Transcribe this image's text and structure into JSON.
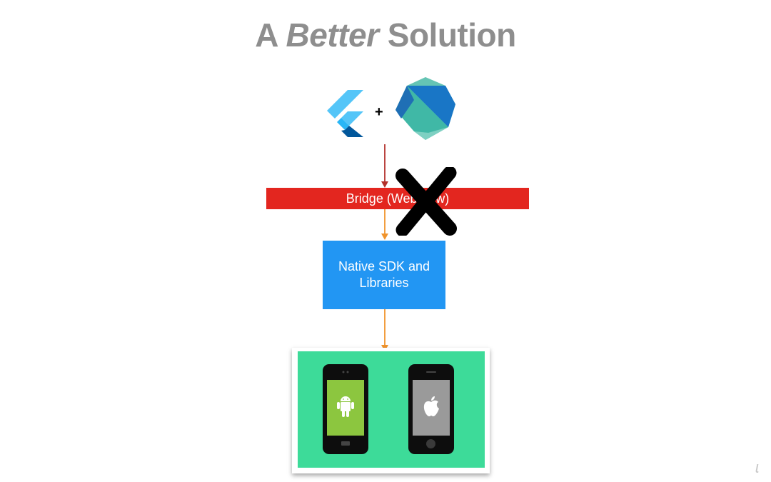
{
  "slide": {
    "title_parts": {
      "prefix": "A ",
      "emphasis": "Better",
      "suffix": " Solution"
    },
    "logos": {
      "left": {
        "icon": "flutter-logo-icon"
      },
      "operator": "+",
      "right": {
        "icon": "dart-logo-icon"
      }
    },
    "bridge": {
      "label": "Bridge (WebView)",
      "status": "crossed-out",
      "color": "#e3261f"
    },
    "native": {
      "label_line1": "Native SDK and",
      "label_line2": "Libraries",
      "color": "#2296f3"
    },
    "platforms": {
      "background_color": "#3ddb99",
      "devices": [
        {
          "name": "Android",
          "icon": "android-icon",
          "screen_color": "#8cc63f"
        },
        {
          "name": "iOS",
          "icon": "apple-icon",
          "screen_color": "#9a9a9a"
        }
      ]
    },
    "colors": {
      "title": "#8e8e8e",
      "arrow_top": "#b3302a",
      "arrow_bottom": "#f0932b"
    }
  }
}
